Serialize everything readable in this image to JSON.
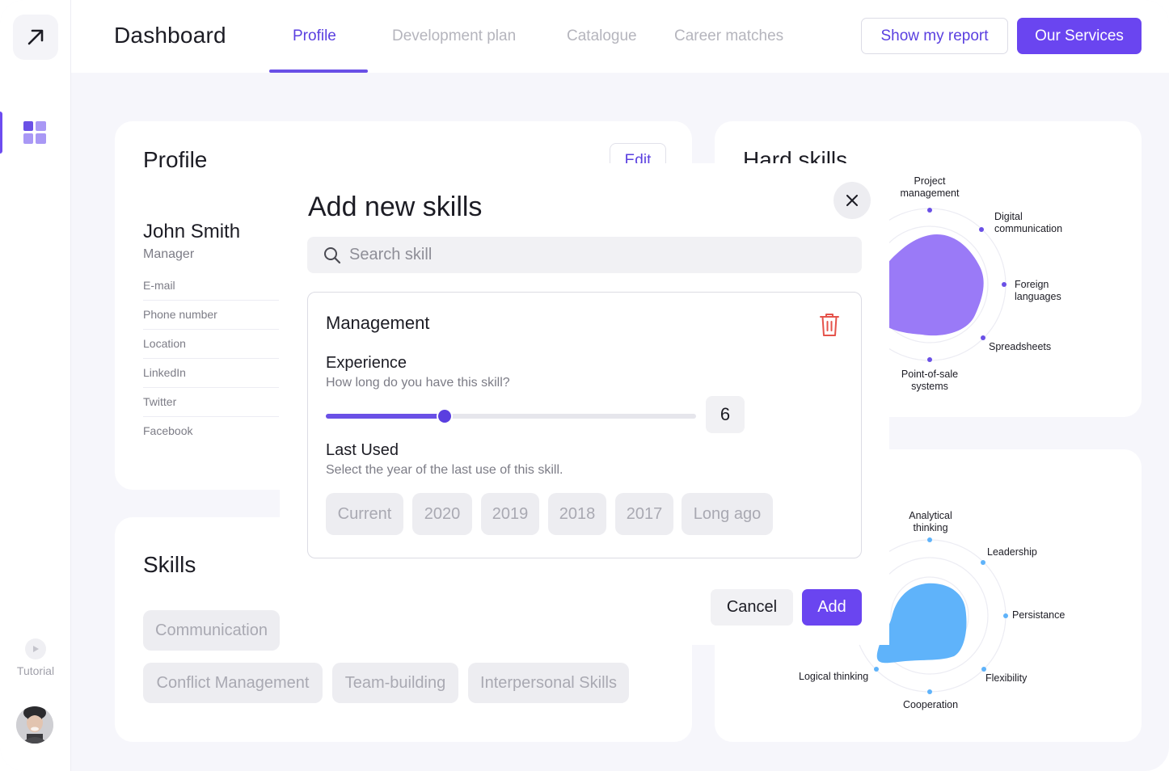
{
  "header": {
    "title": "Dashboard",
    "tabs": [
      "Profile",
      "Development plan",
      "Catalogue",
      "Career matches"
    ],
    "active_tab": "Profile",
    "show_report": "Show my report",
    "our_services": "Our Services"
  },
  "sidebar": {
    "tutorial": "Tutorial"
  },
  "profile": {
    "title": "Profile",
    "edit": "Edit",
    "name": "John Smith",
    "role": "Manager",
    "fields": [
      "E-mail",
      "Phone number",
      "Location",
      "LinkedIn",
      "Twitter",
      "Facebook"
    ]
  },
  "skills": {
    "title": "Skills",
    "chips": [
      "Communication",
      "Conflict Management",
      "Team-building",
      "Interpersonal Skills"
    ]
  },
  "hard_skills": {
    "title": "Hard skills",
    "labels": [
      "Project\nmanagement",
      "Digital\ncommunication",
      "Foreign\nlanguages",
      "Spreadsheets",
      "Point-of-sale\nsystems"
    ]
  },
  "soft_skills": {
    "labels": [
      "Analytical\nthinking",
      "Leadership",
      "Persistance",
      "Flexibility",
      "Cooperation",
      "Logical thinking"
    ]
  },
  "modal": {
    "title": "Add new skills",
    "search_placeholder": "Search skill",
    "skill_name": "Management",
    "experience_label": "Experience",
    "experience_help": "How long do you have this skill?",
    "experience_value": "6",
    "experience_fraction": 0.32,
    "last_used_label": "Last Used",
    "last_used_help": "Select the year of the last use of this skill.",
    "years": [
      "Current",
      "2020",
      "2019",
      "2018",
      "2017",
      "Long ago"
    ],
    "cancel": "Cancel",
    "add": "Add"
  },
  "colors": {
    "accent": "#6a45f0",
    "hard_blob": "#9a7af7",
    "soft_blob": "#5fb3fa",
    "danger": "#e5534b"
  }
}
